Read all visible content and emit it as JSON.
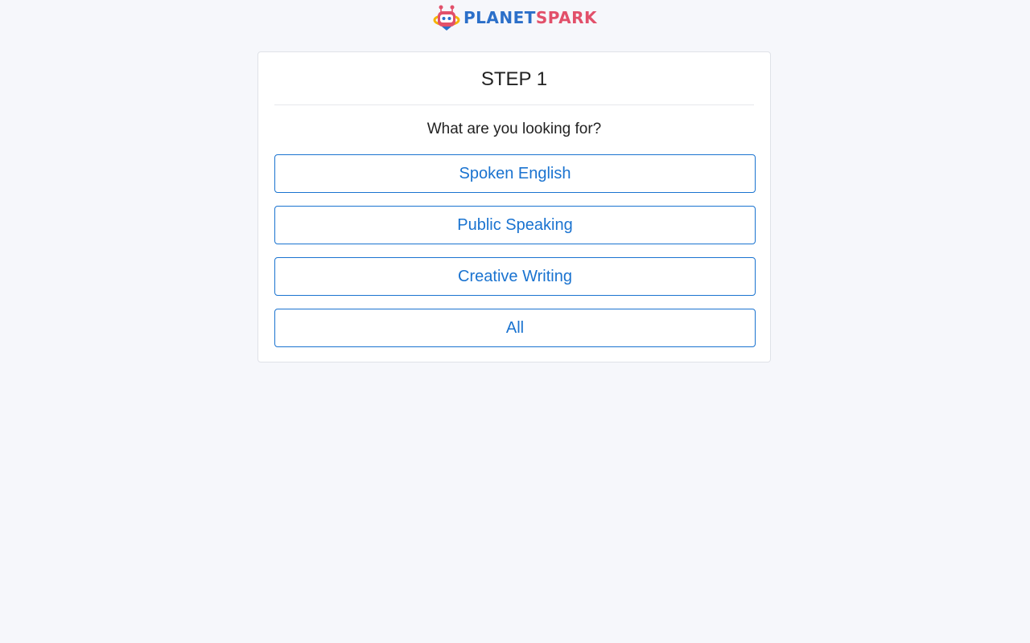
{
  "brand": {
    "name_part1": "PLANET",
    "name_part2": "SPARK",
    "logo_icon": "robot-mascot-icon",
    "colors": {
      "planet": "#2b6fc9",
      "spark": "#e2506a"
    }
  },
  "step": {
    "title": "STEP 1",
    "question": "What are you looking for?",
    "options": [
      {
        "label": "Spoken English"
      },
      {
        "label": "Public Speaking"
      },
      {
        "label": "Creative Writing"
      },
      {
        "label": "All"
      }
    ]
  },
  "colors": {
    "accent": "#1a73d0",
    "background": "#f6f7fb",
    "card": "#ffffff"
  }
}
